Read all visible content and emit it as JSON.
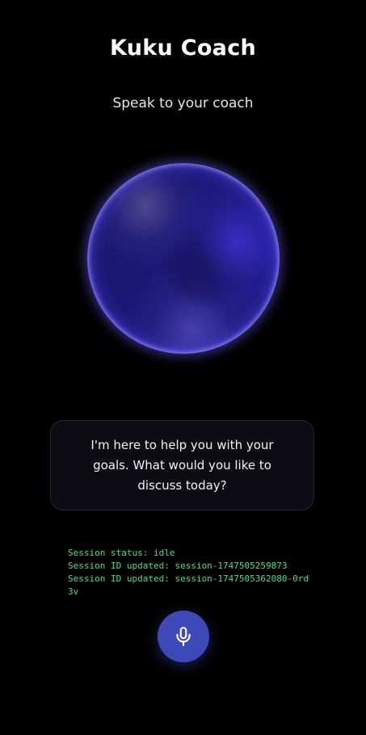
{
  "header": {
    "title": "Kuku Coach",
    "subtitle": "Speak to your coach"
  },
  "orb": {
    "colors": {
      "base": "#1c1a78",
      "highlight": "#3c32d2",
      "rim": "#968cff"
    }
  },
  "message": {
    "text": "I'm here to help you with your goals. What would you like to discuss today?"
  },
  "log": {
    "lines": [
      "Session status: idle",
      "Session ID updated: session-1747505259873",
      "Session ID updated: session-1747505362080-0rd3v"
    ],
    "color": "#4ade80"
  },
  "mic_button": {
    "icon": "microphone-icon",
    "color": "#3f48b8"
  }
}
